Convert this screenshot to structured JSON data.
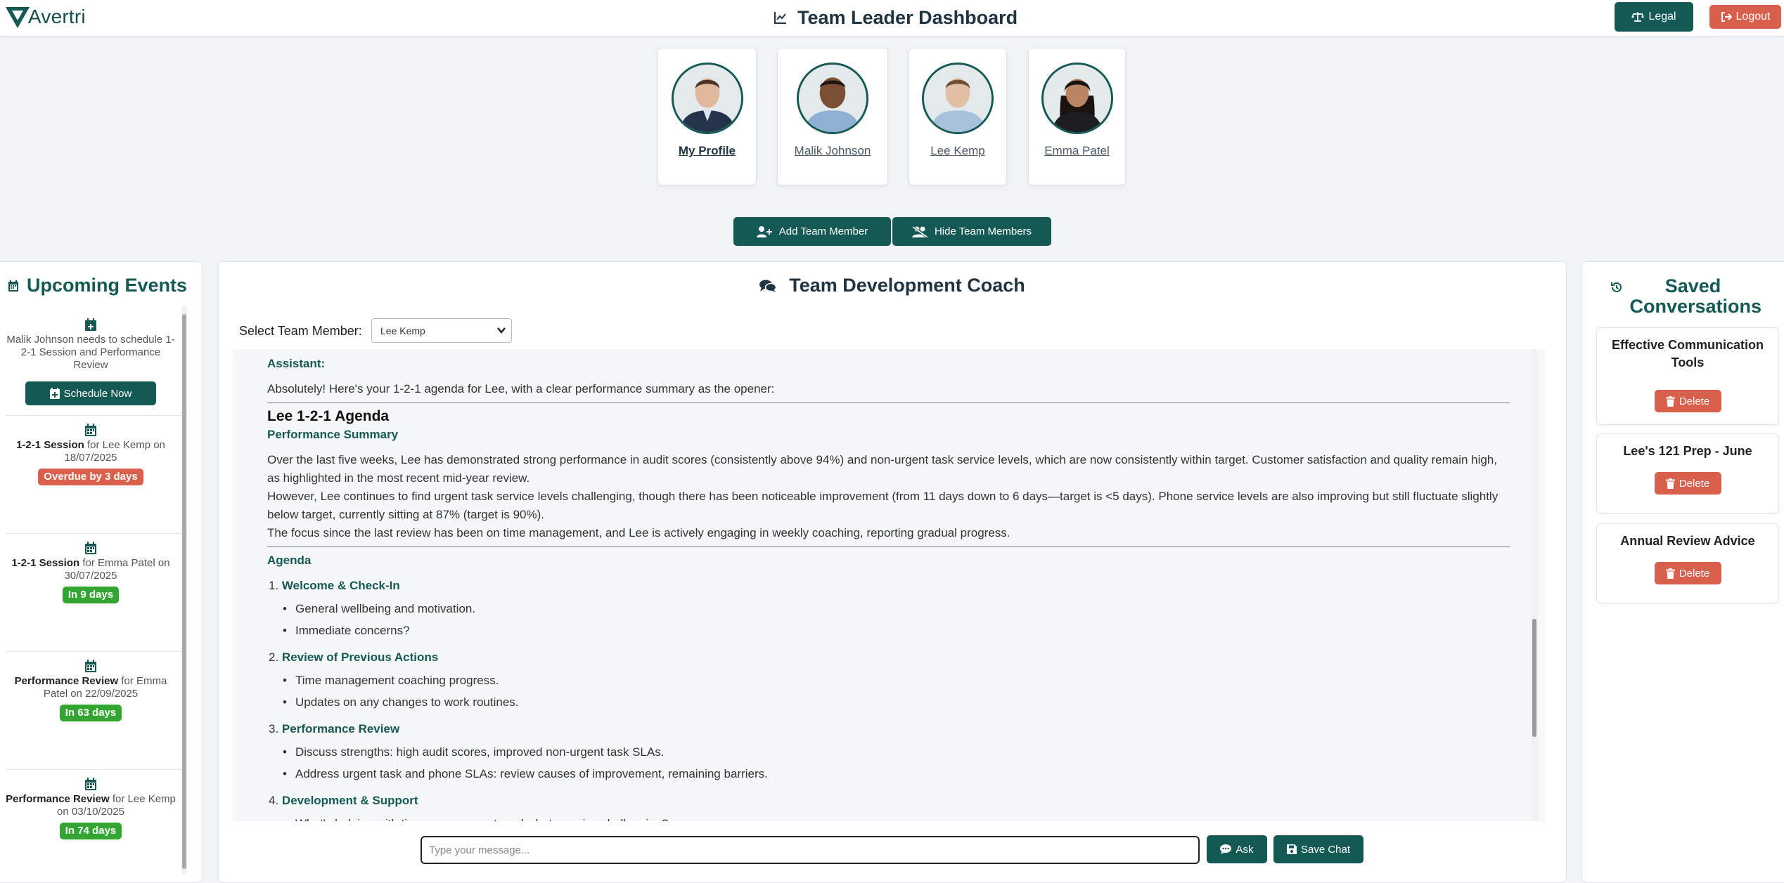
{
  "header": {
    "logo_text": "Avertri",
    "title": "Team Leader Dashboard",
    "legal_label": "Legal",
    "logout_label": "Logout"
  },
  "team": {
    "members": [
      {
        "label": "My Profile"
      },
      {
        "label": "Malik Johnson"
      },
      {
        "label": "Lee Kemp"
      },
      {
        "label": "Emma Patel"
      }
    ],
    "add_label": "Add Team Member",
    "hide_label": "Hide Team Members"
  },
  "events": {
    "title": "Upcoming Events",
    "items": [
      {
        "text": "Malik Johnson needs to schedule 1-2-1 Session and Performance Review",
        "button": "Schedule Now"
      },
      {
        "strong": "1-2-1 Session",
        "rest": " for Lee Kemp on 18/07/2025",
        "badge": "Overdue by 3 days",
        "badge_color": "#d9604d"
      },
      {
        "strong": "1-2-1 Session",
        "rest": " for Emma Patel on 30/07/2025",
        "badge": "In 9 days",
        "badge_color": "#33a532"
      },
      {
        "strong": "Performance Review",
        "rest": " for Emma Patel on 22/09/2025",
        "badge": "In 63 days",
        "badge_color": "#33a532"
      },
      {
        "strong": "Performance Review",
        "rest": " for Lee Kemp on 03/10/2025",
        "badge": "In 74 days",
        "badge_color": "#33a532"
      }
    ]
  },
  "coach": {
    "title": "Team Development Coach",
    "select_label": "Select Team Member:",
    "selected_member": "Lee Kemp",
    "assistant_label": "Assistant:",
    "intro": "Absolutely! Here's your 1-2-1 agenda for Lee, with a clear performance summary as the opener:",
    "agenda_heading": "Lee 1-2-1 Agenda",
    "summary_heading": "Performance Summary",
    "summary_p1": "Over the last five weeks, Lee has demonstrated strong performance in audit scores (consistently above 94%) and non-urgent task service levels, which are now consistently within target. Customer satisfaction and quality remain high, as highlighted in the most recent mid-year review.",
    "summary_p2": "However, Lee continues to find urgent task service levels challenging, though there has been noticeable improvement (from 11 days down to 6 days—target is <5 days). Phone service levels are also improving but still fluctuate slightly below target, currently sitting at 87% (target is 90%).",
    "summary_p3": "The focus since the last review has been on time management, and Lee is actively engaging in weekly coaching, reporting gradual progress.",
    "agenda_label": "Agenda",
    "agenda_items": [
      {
        "num": "1.",
        "title": "Welcome & Check-In",
        "bullets": [
          "General wellbeing and motivation.",
          "Immediate concerns?"
        ]
      },
      {
        "num": "2.",
        "title": "Review of Previous Actions",
        "bullets": [
          "Time management coaching progress.",
          "Updates on any changes to work routines."
        ]
      },
      {
        "num": "3.",
        "title": "Performance Review",
        "bullets": [
          "Discuss strengths: high audit scores, improved non-urgent task SLAs.",
          "Address urgent task and phone SLAs: review causes of improvement, remaining barriers."
        ]
      },
      {
        "num": "4.",
        "title": "Development & Support",
        "bullets": [
          "What's helping with time management, and what remains challenging?"
        ]
      }
    ],
    "input_placeholder": "Type your message...",
    "ask_label": "Ask",
    "save_label": "Save Chat"
  },
  "saved": {
    "title": "Saved Conversations",
    "items": [
      {
        "title": "Effective Communication Tools",
        "delete": "Delete"
      },
      {
        "title": "Lee's 121 Prep - June",
        "delete": "Delete"
      },
      {
        "title": "Annual Review Advice",
        "delete": "Delete"
      }
    ]
  },
  "colors": {
    "brand": "#145954",
    "danger": "#d9604d",
    "success": "#33a532"
  }
}
